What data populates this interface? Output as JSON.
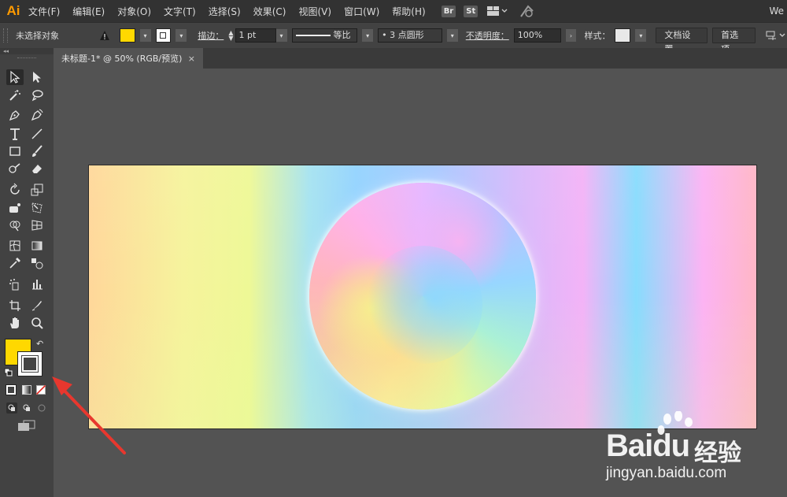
{
  "app": {
    "logo": "Ai",
    "workspace": "We"
  },
  "menu": {
    "items": [
      "文件(F)",
      "编辑(E)",
      "对象(O)",
      "文字(T)",
      "选择(S)",
      "效果(C)",
      "视图(V)",
      "窗口(W)",
      "帮助(H)"
    ],
    "bridge_badge": "Br",
    "stock_badge": "St"
  },
  "control_bar": {
    "selection_status": "未选择对象",
    "fill_color": "#ffd800",
    "stroke_label": "描边：",
    "stroke_weight": "1 pt",
    "stroke_profile": "等比",
    "brush": "3 点圆形",
    "opacity_label": "不透明度：",
    "opacity_value": "100%",
    "style_label": "样式：",
    "doc_setup_button": "文档设置",
    "preferences_button": "首选项"
  },
  "document_tab": {
    "title": "未标题-1* @ 50% (RGB/预览)",
    "close": "×"
  },
  "tools_panel": {
    "fill_color": "#ffd800",
    "stroke_color": "#ffffff"
  },
  "watermark": {
    "brand": "Bai",
    "brand_suffix": "du",
    "cn_text": "经验",
    "url": "jingyan.baidu.com"
  },
  "colors": {
    "accent_arrow": "#e8372e",
    "app_logo": "#ff9a00"
  }
}
